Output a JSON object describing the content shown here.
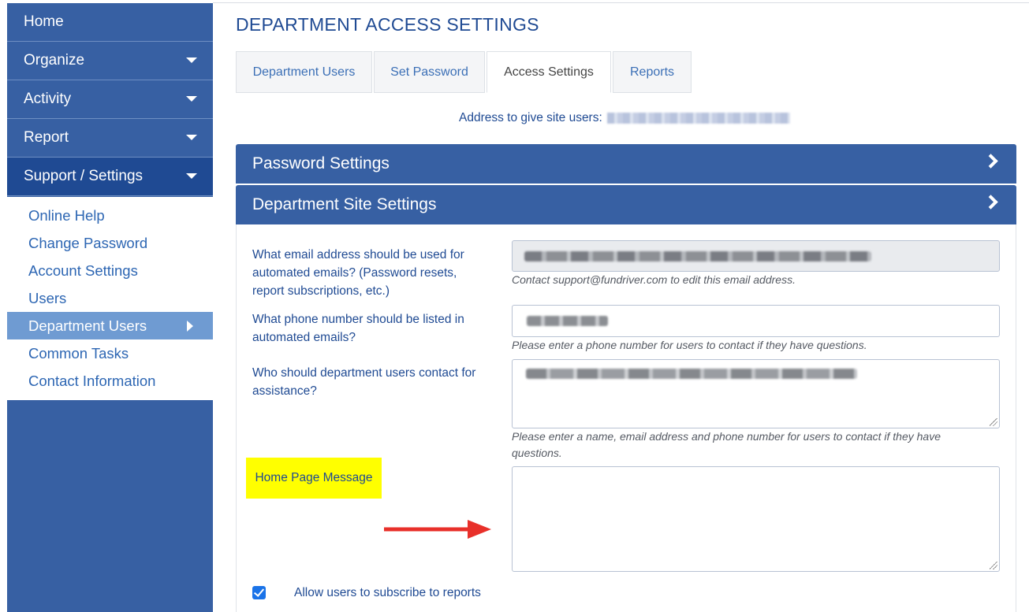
{
  "sidebar": {
    "nav": [
      {
        "label": "Home",
        "has_caret": false
      },
      {
        "label": "Organize",
        "has_caret": true
      },
      {
        "label": "Activity",
        "has_caret": true
      },
      {
        "label": "Report",
        "has_caret": true
      },
      {
        "label": "Support / Settings",
        "has_caret": true,
        "active": true
      }
    ],
    "submenu": [
      {
        "label": "Online Help"
      },
      {
        "label": "Change Password"
      },
      {
        "label": "Account Settings"
      },
      {
        "label": "Users"
      },
      {
        "label": "Department Users",
        "selected": true
      },
      {
        "label": "Common Tasks"
      },
      {
        "label": "Contact Information"
      }
    ]
  },
  "page": {
    "title": "DEPARTMENT ACCESS SETTINGS",
    "tabs": [
      {
        "label": "Department Users"
      },
      {
        "label": "Set Password"
      },
      {
        "label": "Access Settings",
        "active": true
      },
      {
        "label": "Reports"
      }
    ],
    "address_label": "Address to give site users:"
  },
  "panels": {
    "password_settings": "Password Settings",
    "department_site_settings": "Department Site Settings"
  },
  "form": {
    "email_question": "What email address should be used for automated emails? (Password resets, report subscriptions, etc.)",
    "email_help": "Contact support@fundriver.com to edit this email address.",
    "phone_question": "What phone number should be listed in automated emails?",
    "phone_help": "Please enter a phone number for users to contact if they have questions.",
    "contact_question": "Who should department users contact for assistance?",
    "contact_help": "Please enter a name, email address and phone number for users to contact if they have questions.",
    "home_page_message_label": "Home Page Message",
    "home_page_message_value": "",
    "subscribe_label": "Allow users to subscribe to reports",
    "subscribe_checked": true
  },
  "colors": {
    "sidebar": "#3760a3",
    "accent_text": "#1f4a93",
    "highlight": "#ffff00",
    "arrow": "#e8302a"
  }
}
